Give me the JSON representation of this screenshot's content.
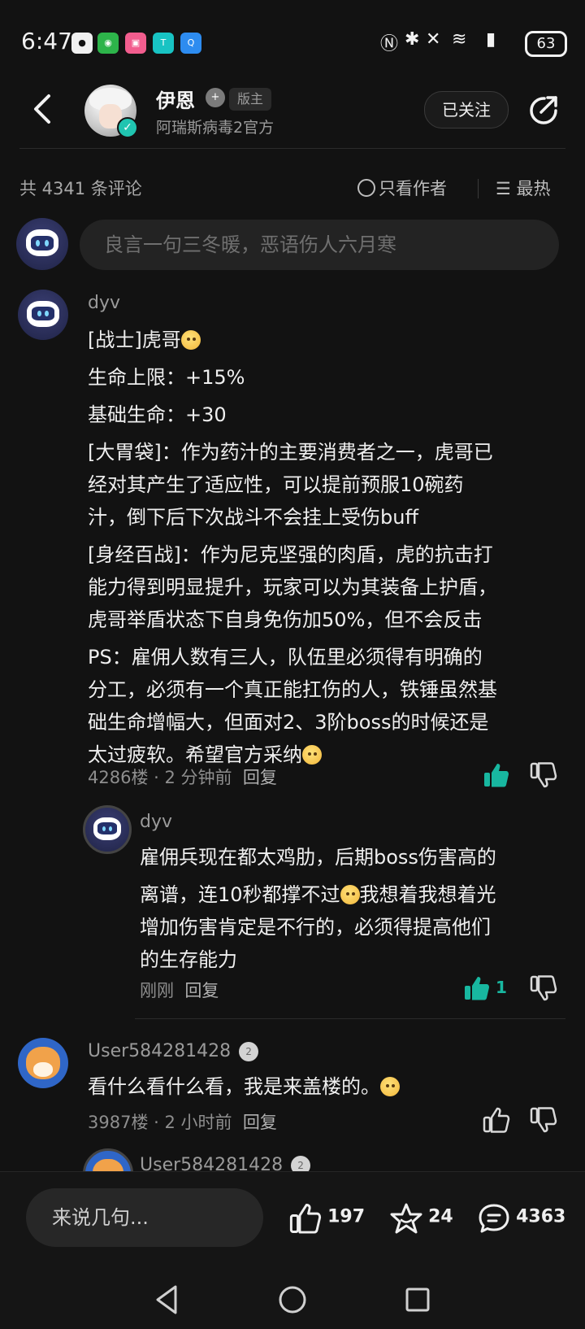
{
  "status_bar": {
    "time": "6:47",
    "battery": "63"
  },
  "header": {
    "name": "伊恩",
    "badge": "版主",
    "subtitle": "阿瑞斯病毒2官方",
    "follow_label": "已关注"
  },
  "filter": {
    "count_text": "共 4341 条评论",
    "only_author": "只看作者",
    "sort": "最热"
  },
  "input": {
    "placeholder": "良言一句三冬暖，恶语伤人六月寒"
  },
  "comments": [
    {
      "user": "dyv",
      "lines": [
        "[战士]虎哥",
        "生命上限：+15%",
        "基础生命：+30",
        "[大胃袋]：作为药汁的主要消费者之一，虎哥已",
        "经对其产生了适应性，可以提前预服10碗药",
        "汁，倒下后下次战斗不会挂上受伤buff",
        "[身经百战]：作为尼克坚强的肉盾，虎的抗击打",
        "能力得到明显提升，玩家可以为其装备上护盾，",
        "虎哥举盾状态下自身免伤加50%，但不会反击",
        "PS：雇佣人数有三人，队伍里必须得有明确的",
        "分工，必须有一个真正能扛伤的人，铁锤虽然基",
        "础生命增幅大，但面对2、3阶boss的时候还是",
        "太过疲软。希望官方采纳"
      ],
      "floor": "4286楼",
      "time": "2 分钟前",
      "reply": "回复",
      "reply_item": {
        "user": "dyv",
        "lines": [
          "雇佣兵现在都太鸡肋，后期boss伤害高的",
          "离谱，连10秒都撑不过",
          "我想着我想着光",
          "增加伤害肯定是不行的，必须得提高他们",
          "的生存能力"
        ],
        "time": "刚刚",
        "reply": "回复",
        "likes": "1"
      }
    },
    {
      "user": "User584281428",
      "level": "2",
      "text": "看什么看什么看，我是来盖楼的。",
      "floor": "3987楼",
      "time": "2 小时前",
      "reply": "回复",
      "reply_user": "User584281428"
    }
  ],
  "bottom": {
    "placeholder": "来说几句...",
    "likes": "197",
    "favorites": "24",
    "comments": "4363"
  },
  "colors": {
    "accent": "#18b7a0",
    "background": "#121212"
  }
}
